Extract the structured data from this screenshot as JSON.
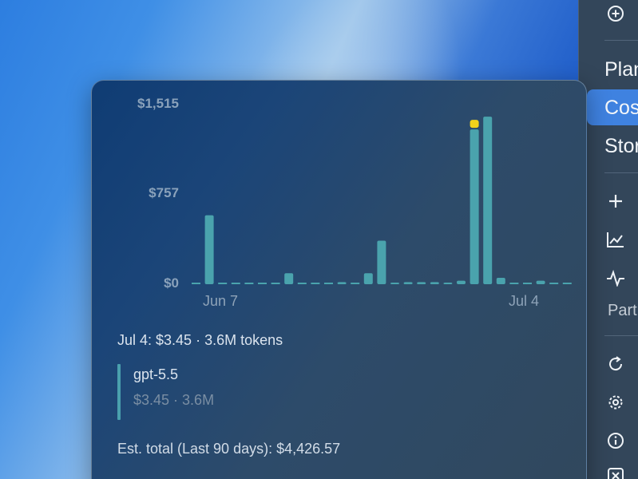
{
  "menu": {
    "items": [
      {
        "label": "Plan",
        "visible": "Plan"
      },
      {
        "label": "Cost",
        "visible": "Cos",
        "selected": true
      },
      {
        "label": "Storage",
        "visible": "Stor"
      }
    ],
    "section_label": "Part",
    "icons": [
      "plus-circle-icon",
      "plus-icon",
      "line-chart-icon",
      "pulse-icon",
      "refresh-icon",
      "gear-icon",
      "info-icon",
      "close-box-icon"
    ]
  },
  "popover": {
    "detail_date": "Jul 4: $3.45 · 3.6M tokens",
    "model_name": "gpt-5.5",
    "model_cost": "$3.45 · 3.6M",
    "total": "Est. total (Last 90 days): $4,426.57"
  },
  "chart_data": {
    "type": "bar",
    "ytick_labels": [
      "$1,515",
      "$757",
      "$0"
    ],
    "yticks": [
      1515,
      757,
      0
    ],
    "xtick_labels": [
      "Jun 7",
      "Jul 4"
    ],
    "ylim": [
      0,
      1515
    ],
    "highlight_index": 21,
    "colors": {
      "bar": "#4aa3ad",
      "highlight": "#f2d21a"
    },
    "values": [
      0,
      595,
      0,
      0,
      0,
      0,
      0,
      95,
      0,
      0,
      0,
      18,
      0,
      95,
      375,
      5,
      18,
      18,
      18,
      5,
      30,
      1335,
      1445,
      55,
      0,
      0,
      30,
      0,
      0
    ]
  }
}
